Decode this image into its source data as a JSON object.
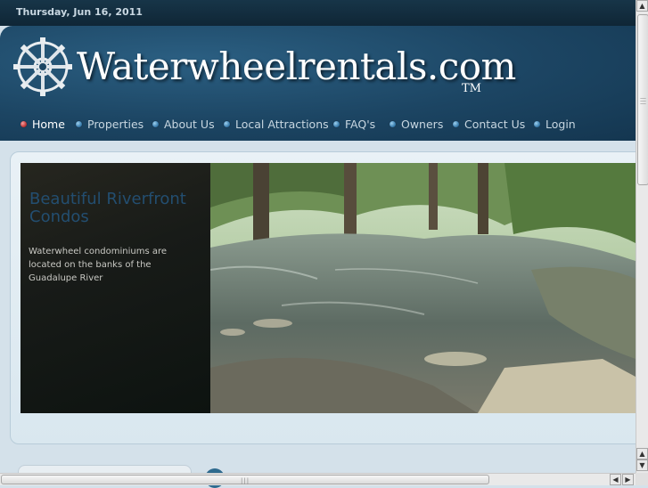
{
  "topbar": {
    "date": "Thursday, Jun 16, 2011"
  },
  "header": {
    "site_name": "Waterwheelrentals.com",
    "trademark": "TM",
    "logo_icon": "waterwheel-logo-icon"
  },
  "nav": {
    "items": [
      {
        "label": "Home",
        "active": true
      },
      {
        "label": "Properties",
        "active": false
      },
      {
        "label": "About Us",
        "active": false
      },
      {
        "label": "Local Attractions",
        "active": false
      },
      {
        "label": "FAQ's",
        "active": false
      },
      {
        "label": "Owners",
        "active": false
      },
      {
        "label": "Contact Us",
        "active": false
      },
      {
        "label": "Login",
        "active": false
      }
    ],
    "bullet_icon": "nav-bullet-icon"
  },
  "slider": {
    "title": "Beautiful Riverfront Condos",
    "text": "Waterwheel condominiums are located on the banks of the Guadalupe River",
    "photo_description_icon": "river-photo"
  },
  "colors": {
    "accent_blue": "#1c4563",
    "topbar": "#173548",
    "caption_title": "#234e70",
    "active_bullet": "#c23a3a"
  },
  "scrollbars": {
    "up_arrow": "▲",
    "down_arrow": "▼",
    "left_arrow": "◀",
    "right_arrow": "▶"
  }
}
